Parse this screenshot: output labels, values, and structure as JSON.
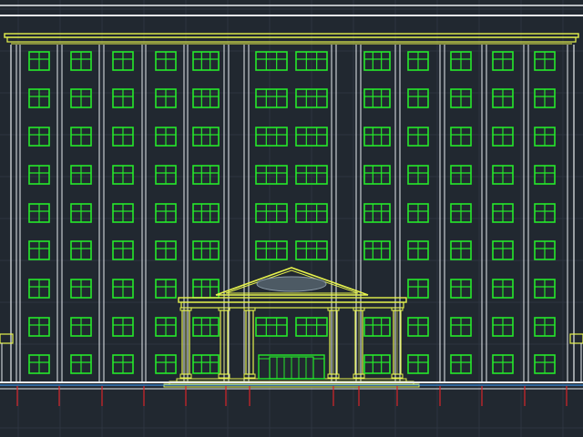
{
  "drawing": {
    "background": "#212830",
    "grid_color": "#2d3540",
    "line_white": "#e8ecef",
    "line_yellow": "#e6f24d",
    "line_green": "#25e82a",
    "line_red": "#d8262b",
    "line_blue": "#3aa0ff",
    "floors": 9,
    "window_columns": 13,
    "entrance": {
      "columns": 6,
      "has_pediment": true,
      "has_double_doors": true
    }
  }
}
